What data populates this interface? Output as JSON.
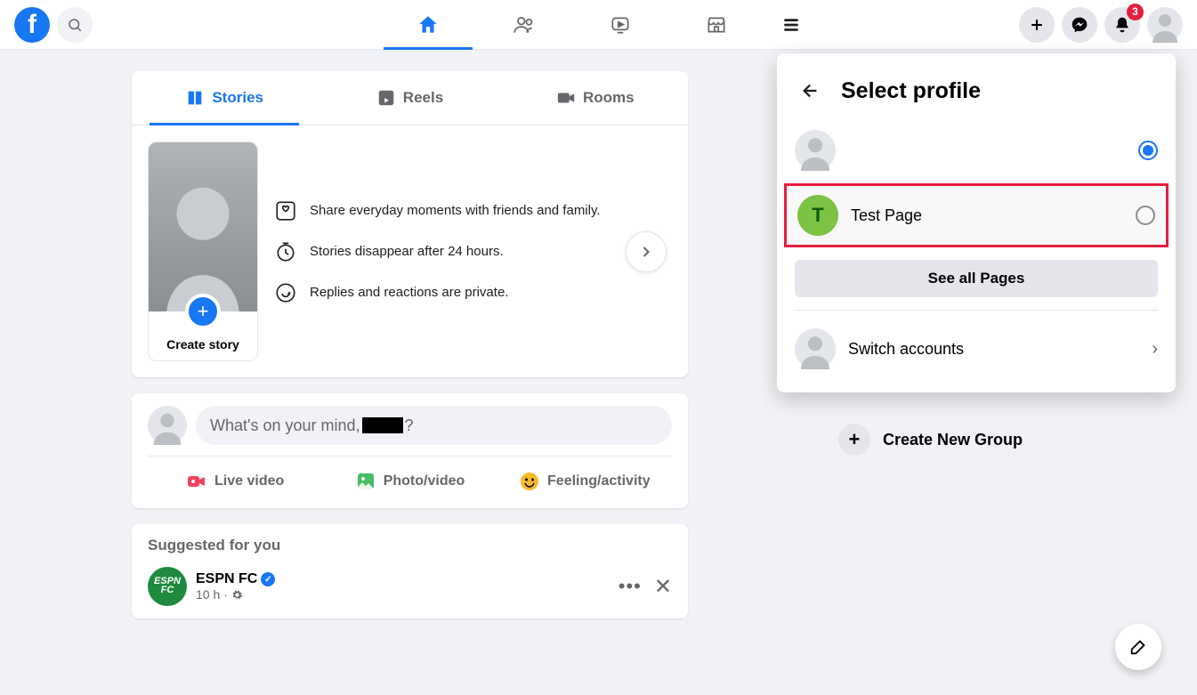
{
  "header": {
    "notif_count": "3"
  },
  "tabs": {
    "stories": "Stories",
    "reels": "Reels",
    "rooms": "Rooms"
  },
  "stories": {
    "create": "Create story",
    "info1": "Share everyday moments with friends and family.",
    "info2": "Stories disappear after 24 hours.",
    "info3": "Replies and reactions are private."
  },
  "composer": {
    "prefix": "What's on your mind, ",
    "suffix": "?",
    "live": "Live video",
    "photo": "Photo/video",
    "feeling": "Feeling/activity"
  },
  "suggested": {
    "title": "Suggested for you",
    "name": "ESPN FC",
    "time": "10 h",
    "sep": " · "
  },
  "dropdown": {
    "title": "Select profile",
    "page_name": "Test Page",
    "page_initial": "T",
    "see_all": "See all Pages",
    "switch": "Switch accounts"
  },
  "sidebar": {
    "create_group": "Create New Group"
  }
}
